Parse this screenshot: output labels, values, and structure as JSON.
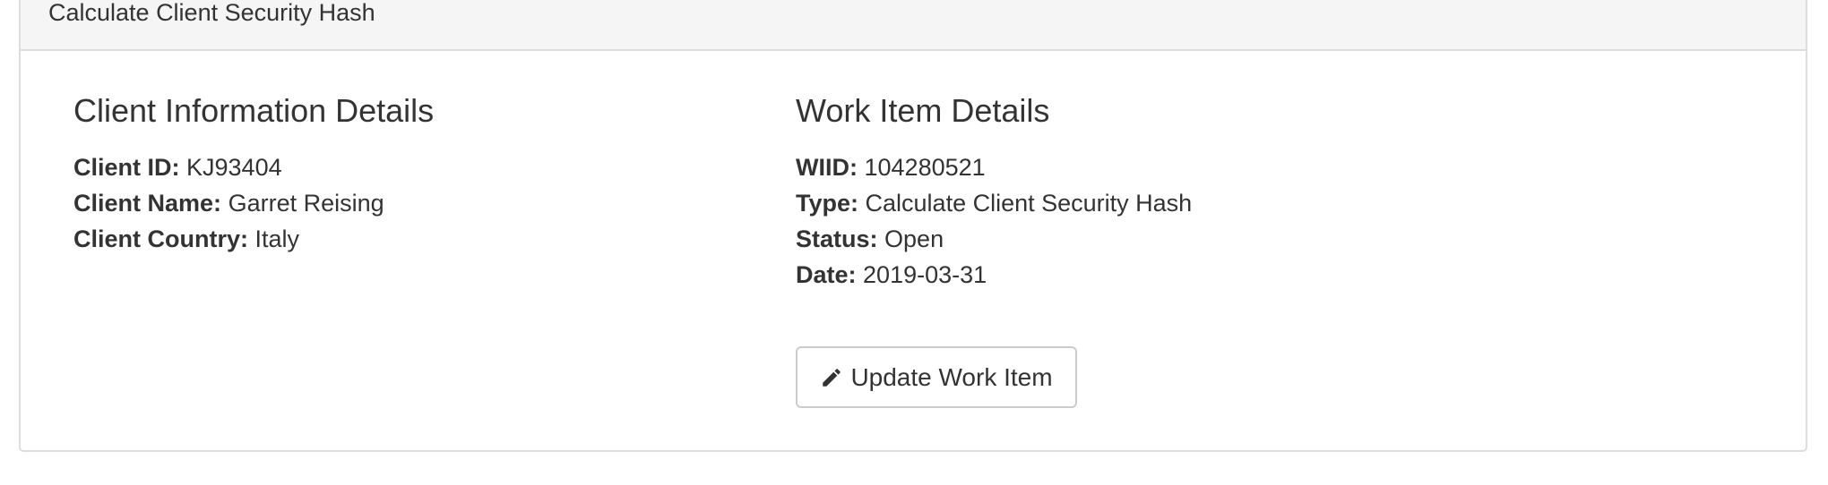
{
  "panel": {
    "heading": "Calculate Client Security Hash"
  },
  "client": {
    "title": "Client Information Details",
    "id_label": "Client ID:",
    "id_value": "KJ93404",
    "name_label": "Client Name:",
    "name_value": "Garret Reising",
    "country_label": "Client Country:",
    "country_value": "Italy"
  },
  "work_item": {
    "title": "Work Item Details",
    "wiid_label": "WIID:",
    "wiid_value": "104280521",
    "type_label": "Type:",
    "type_value": "Calculate Client Security Hash",
    "status_label": "Status:",
    "status_value": "Open",
    "date_label": "Date:",
    "date_value": "2019-03-31"
  },
  "actions": {
    "update_label": "Update Work Item",
    "update_icon": "pencil-icon"
  }
}
